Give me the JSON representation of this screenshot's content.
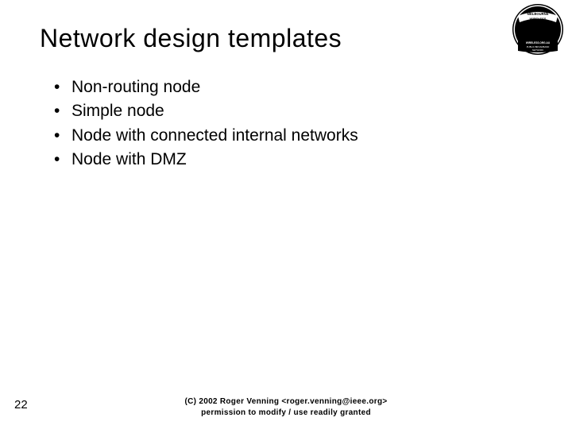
{
  "title": "Network design templates",
  "bullets": [
    "Non-routing node",
    "Simple node",
    "Node with connected internal networks",
    "Node with DMZ"
  ],
  "page_number": "22",
  "footer_line1": "(C) 2002 Roger Venning <roger.venning@ieee.org>",
  "footer_line2": "permission to modify / use readily granted",
  "logo": {
    "top_text": "MELBOURNE",
    "top_text2": "WIRELESS",
    "bottom_text": "WIRELESS.ORG.AU",
    "bottom_text2": "PUBLIC BROADBAND",
    "bottom_text3": "NETWORK"
  }
}
